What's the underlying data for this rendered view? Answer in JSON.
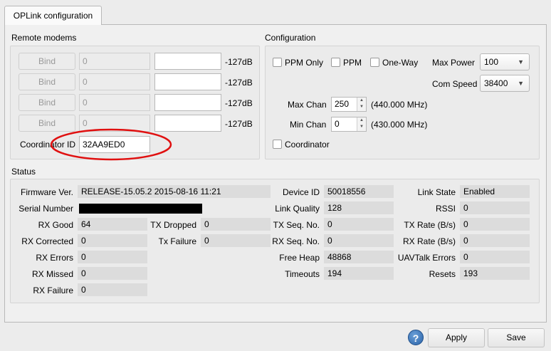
{
  "tab": {
    "label": "OPLink configuration"
  },
  "remote_modems": {
    "title": "Remote modems",
    "rows": [
      {
        "bind_label": "Bind",
        "id": "0",
        "signal": "-127dB"
      },
      {
        "bind_label": "Bind",
        "id": "0",
        "signal": "-127dB"
      },
      {
        "bind_label": "Bind",
        "id": "0",
        "signal": "-127dB"
      },
      {
        "bind_label": "Bind",
        "id": "0",
        "signal": "-127dB"
      }
    ],
    "coordinator_label": "Coordinator ID",
    "coordinator_value": "32AA9ED0",
    "annotation_color": "#e01010"
  },
  "configuration": {
    "title": "Configuration",
    "ppm_only": "PPM Only",
    "ppm": "PPM",
    "one_way": "One-Way",
    "max_power_label": "Max Power",
    "max_power_value": "100",
    "com_speed_label": "Com Speed",
    "com_speed_value": "38400",
    "max_chan_label": "Max Chan",
    "max_chan_value": "250",
    "max_chan_freq": "(440.000 MHz)",
    "min_chan_label": "Min Chan",
    "min_chan_value": "0",
    "min_chan_freq": "(430.000 MHz)",
    "coordinator": "Coordinator"
  },
  "status": {
    "title": "Status",
    "firmware_label": "Firmware Ver.",
    "firmware_value": "RELEASE-15.05.2 2015-08-16 11:21",
    "serial_label": "Serial Number",
    "rx_good_label": "RX Good",
    "rx_good": "64",
    "rx_corrected_label": "RX Corrected",
    "rx_corrected": "0",
    "rx_errors_label": "RX Errors",
    "rx_errors": "0",
    "rx_missed_label": "RX Missed",
    "rx_missed": "0",
    "rx_failure_label": "RX Failure",
    "rx_failure": "0",
    "tx_dropped_label": "TX Dropped",
    "tx_dropped": "0",
    "tx_failure_label": "Tx Failure",
    "tx_failure": "0",
    "device_id_label": "Device ID",
    "device_id": "50018556",
    "link_quality_label": "Link Quality",
    "link_quality": "128",
    "tx_seq_label": "TX Seq. No.",
    "tx_seq": "0",
    "rx_seq_label": "RX Seq. No.",
    "rx_seq": "0",
    "free_heap_label": "Free Heap",
    "free_heap": "48868",
    "timeouts_label": "Timeouts",
    "timeouts": "194",
    "link_state_label": "Link State",
    "link_state": "Enabled",
    "rssi_label": "RSSI",
    "rssi": "0",
    "tx_rate_label": "TX Rate (B/s)",
    "tx_rate": "0",
    "rx_rate_label": "RX Rate (B/s)",
    "rx_rate": "0",
    "uavtalk_label": "UAVTalk Errors",
    "uavtalk": "0",
    "resets_label": "Resets",
    "resets": "193"
  },
  "footer": {
    "help": "?",
    "apply": "Apply",
    "save": "Save"
  }
}
